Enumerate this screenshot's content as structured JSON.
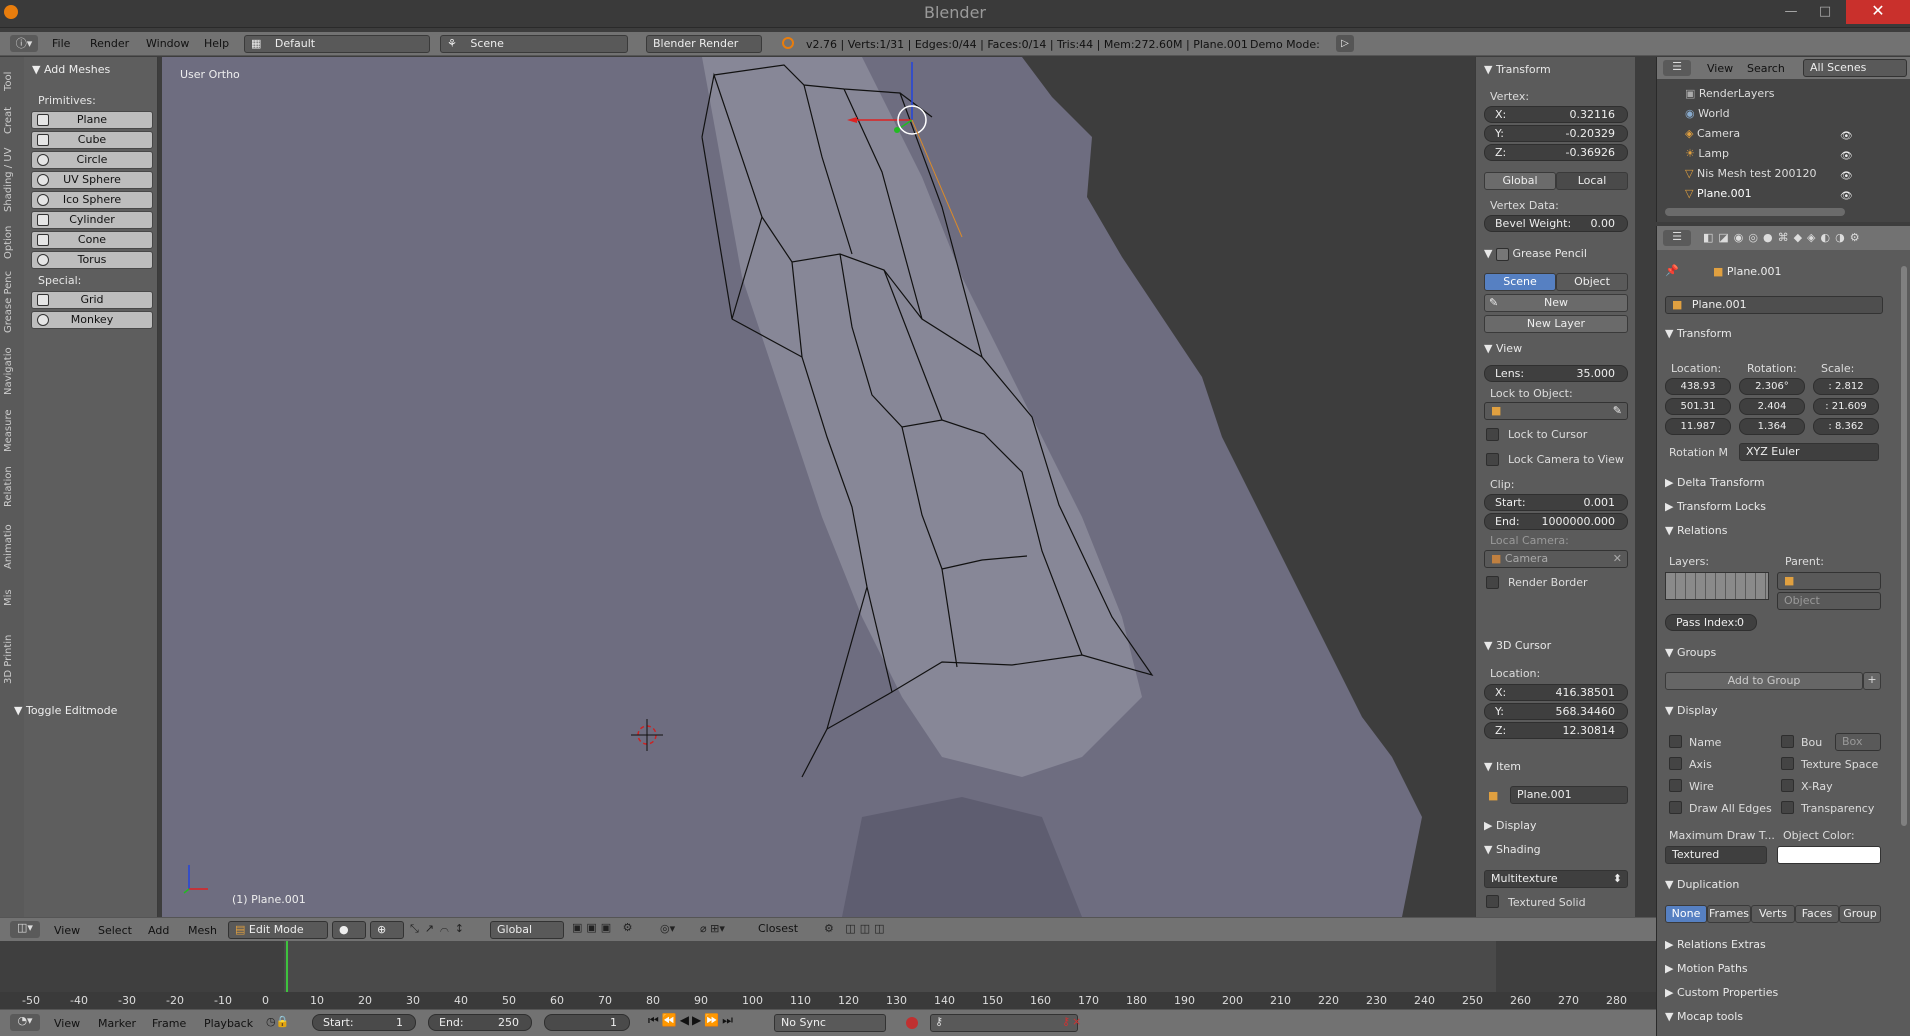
{
  "app_title": "Blender",
  "menu": {
    "items": [
      "File",
      "Render",
      "Window",
      "Help"
    ],
    "screen_layout": "Default",
    "scene": "Scene",
    "engine": "Blender Render",
    "stats": "v2.76 | Verts:1/31 | Edges:0/44 | Faces:0/14 | Tris:44 | Mem:272.60M | Plane.001",
    "demo_mode": "Demo Mode:"
  },
  "tool_tabs": [
    "Tool",
    "Creat",
    "Shading / UV",
    "Option",
    "Grease Penc",
    "Navigatio",
    "Measure",
    "Relation",
    "Animatio",
    "Mis",
    "3D Printin"
  ],
  "add_meshes": {
    "title": "Add Meshes",
    "primitives_label": "Primitives:",
    "primitives": [
      "Plane",
      "Cube",
      "Circle",
      "UV Sphere",
      "Ico Sphere",
      "Cylinder",
      "Cone",
      "Torus"
    ],
    "special_label": "Special:",
    "special": [
      "Grid",
      "Monkey"
    ],
    "toggle_editmode": "Toggle Editmode"
  },
  "viewport": {
    "label": "User Ortho",
    "object_label": "(1) Plane.001"
  },
  "npanel": {
    "transform_title": "Transform",
    "vertex_label": "Vertex:",
    "x_label": "X:",
    "x": "0.32116",
    "y_label": "Y:",
    "y": "-0.20329",
    "z_label": "Z:",
    "z": "-0.36926",
    "global": "Global",
    "local": "Local",
    "vertex_data": "Vertex Data:",
    "bevel_label": "Bevel Weight:",
    "bevel": "0.00",
    "grease_title": "Grease Pencil",
    "scene_btn": "Scene",
    "object_btn": "Object",
    "new_btn": "New",
    "new_layer": "New Layer",
    "view_title": "View",
    "lens_label": "Lens:",
    "lens": "35.000",
    "lock_obj": "Lock to Object:",
    "lock_cursor": "Lock to Cursor",
    "lock_cam": "Lock Camera to View",
    "clip": "Clip:",
    "start_label": "Start:",
    "start": "0.001",
    "end_label": "End:",
    "end": "1000000.000",
    "local_cam": "Local Camera:",
    "camera": "Camera",
    "render_border": "Render Border",
    "cursor_title": "3D Cursor",
    "location": "Location:",
    "cx": "416.38501",
    "cy": "568.34460",
    "cz": "12.30814",
    "item_title": "Item",
    "item_name": "Plane.001",
    "display_title": "Display",
    "shading_title": "Shading",
    "shading_mode": "Multitexture",
    "textured_solid": "Textured Solid"
  },
  "outliner": {
    "view": "View",
    "search": "Search",
    "scenes": "All Scenes",
    "items": [
      "RenderLayers",
      "World",
      "Camera",
      "Lamp",
      "Nis Mesh test 200120",
      "Plane.001"
    ]
  },
  "props": {
    "object_name": "Plane.001",
    "breadcrumb": "Plane.001",
    "transform": "Transform",
    "location": "Location:",
    "rotation": "Rotation:",
    "scale": "Scale:",
    "loc": [
      "438.93",
      "501.31",
      "11.987"
    ],
    "rot": [
      "2.306°",
      "2.404",
      "1.364"
    ],
    "scl": [
      ": 2.812",
      ": 21.609",
      ": 8.362"
    ],
    "rotation_mode_label": "Rotation M",
    "rotation_mode": "XYZ Euler",
    "delta": "Delta Transform",
    "locks": "Transform Locks",
    "relations": "Relations",
    "layers": "Layers:",
    "parent": "Parent:",
    "parent_type": "Object",
    "pass_index": "Pass Index:",
    "pass_val": "0",
    "groups": "Groups",
    "add_group": "Add to Group",
    "display": "Display",
    "name": "Name",
    "bou": "Bou",
    "box": "Box",
    "axis": "Axis",
    "texture_space": "Texture Space",
    "wire": "Wire",
    "xray": "X-Ray",
    "draw_edges": "Draw All Edges",
    "transparency": "Transparency",
    "max_draw": "Maximum Draw T...",
    "obj_color": "Object Color:",
    "textured": "Textured",
    "duplication": "Duplication",
    "dup_opts": [
      "None",
      "Frames",
      "Verts",
      "Faces",
      "Group"
    ],
    "relations_extras": "Relations Extras",
    "motion_paths": "Motion Paths",
    "custom_props": "Custom Properties",
    "mocap": "Mocap tools"
  },
  "header3d": {
    "items": [
      "View",
      "Select",
      "Add",
      "Mesh"
    ],
    "mode": "Edit Mode",
    "orientation": "Global",
    "snap": "Closest"
  },
  "timeline": {
    "ticks": [
      "-50",
      "-40",
      "-30",
      "-20",
      "-10",
      "0",
      "10",
      "20",
      "30",
      "40",
      "50",
      "60",
      "70",
      "80",
      "90",
      "100",
      "110",
      "120",
      "130",
      "140",
      "150",
      "160",
      "170",
      "180",
      "190",
      "200",
      "210",
      "220",
      "230",
      "240",
      "250",
      "260",
      "270",
      "280"
    ],
    "menu": [
      "View",
      "Marker",
      "Frame",
      "Playback"
    ],
    "start_label": "Start:",
    "start": "1",
    "end_label": "End:",
    "end": "250",
    "current": "1",
    "sync": "No Sync"
  }
}
